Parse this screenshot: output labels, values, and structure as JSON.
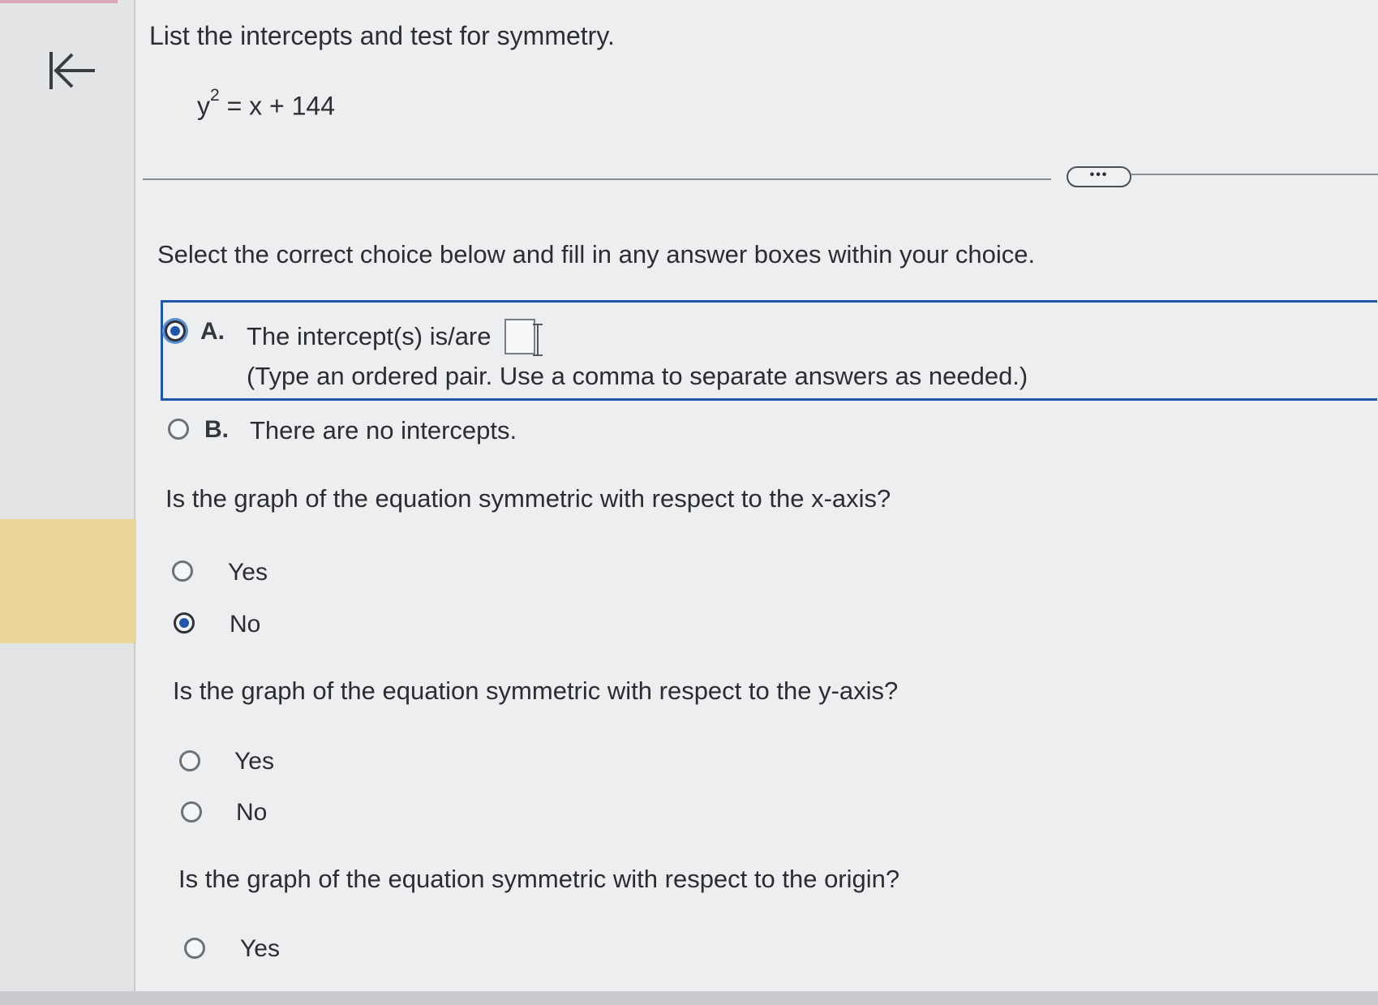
{
  "question": {
    "title": "List the intercepts and test for symmetry.",
    "equation_base": "y",
    "equation_exponent": "2",
    "equation_rest": " = x + 144"
  },
  "toolbar": {
    "more_label": "•••"
  },
  "instruction": "Select the correct choice below and fill in any answer boxes within your choice.",
  "intercepts": {
    "choice_a_letter": "A.",
    "choice_a_text": "The intercept(s) is/are",
    "choice_a_hint": "(Type an ordered pair.  Use a comma to separate answers as needed.)",
    "choice_a_selected": true,
    "answer_value": "",
    "choice_b_letter": "B.",
    "choice_b_text": "There are no intercepts.",
    "choice_b_selected": false
  },
  "x_axis": {
    "prompt": "Is the graph of the equation symmetric with respect to the x-axis?",
    "yes_label": "Yes",
    "no_label": "No",
    "selected": "No"
  },
  "y_axis": {
    "prompt": "Is the graph of the equation symmetric with respect to the y-axis?",
    "yes_label": "Yes",
    "no_label": "No",
    "selected": ""
  },
  "origin": {
    "prompt": "Is the graph of the equation symmetric with respect to the origin?",
    "yes_label": "Yes",
    "selected": ""
  },
  "colors": {
    "accent": "#1e56a8",
    "highlight": "#ecd79a"
  },
  "icons": {
    "collapse": "collapse-left-icon",
    "text_cursor": "text-cursor-icon"
  }
}
